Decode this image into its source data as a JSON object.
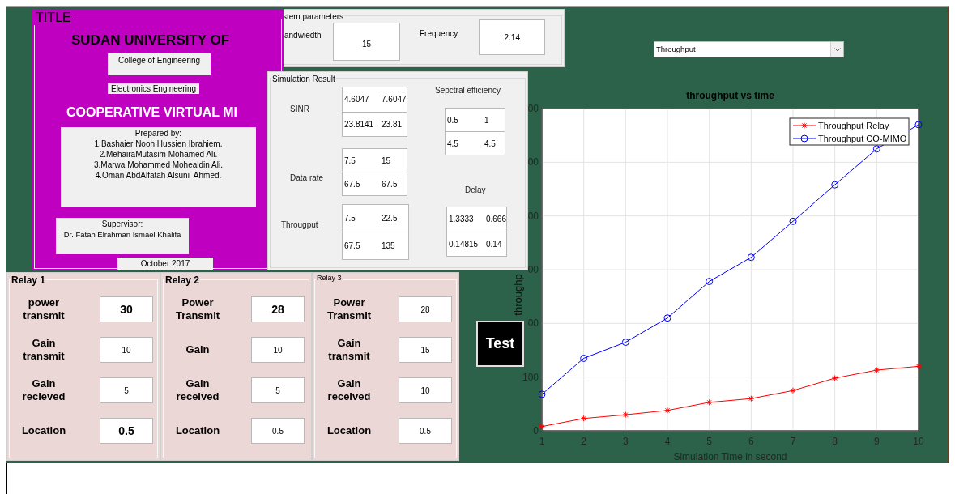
{
  "title_panel": {
    "label": "TITLE",
    "university": "SUDAN UNIVERSITY OF",
    "college": "College of Engineering",
    "department": "Electronics Engineering",
    "project": "COOPERATIVE VIRTUAL MI",
    "prepared_by": {
      "heading": "Prepared by:",
      "names": [
        "1.Bashaier Nooh Hussien Ibrahiem.",
        "2.MehairaMutasim Mohamed Ali.",
        "3.Marwa Mohammed Mohealdin Ali.",
        "4.Oman AbdAlfatah Alsuni  Ahmed."
      ]
    },
    "supervisor": {
      "heading": "Supervisor:",
      "name": "Dr. Fatah Elrahman Ismael Khalifa"
    },
    "date": "October 2017"
  },
  "system_parameters": {
    "label": "stem parameters",
    "fields": [
      {
        "label": "andwiedth",
        "value": "15"
      },
      {
        "label": "Frequency",
        "value": "2.14"
      }
    ]
  },
  "simulation_result": {
    "label": "Simulation Result",
    "groups": [
      {
        "label": "SINR",
        "rows": [
          [
            "4.6047",
            "7.6047"
          ],
          [
            "23.8141",
            "23.81"
          ]
        ]
      },
      {
        "label": "Data rate",
        "rows": [
          [
            "7.5",
            "15"
          ],
          [
            "67.5",
            "67.5"
          ]
        ]
      },
      {
        "label": "Througput",
        "rows": [
          [
            "7.5",
            "22.5"
          ],
          [
            "67.5",
            "135"
          ]
        ]
      },
      {
        "label": "Sepctral efficiency",
        "rows": [
          [
            "0.5",
            "1"
          ],
          [
            "4.5",
            "4.5"
          ]
        ]
      },
      {
        "label": "Delay",
        "rows": [
          [
            "1.3333",
            "0.666"
          ],
          [
            "0.14815",
            "0.14"
          ]
        ]
      }
    ]
  },
  "relays": [
    {
      "title": "Relay 1",
      "title_bold": true,
      "fields": [
        {
          "label": "power transmit",
          "value": "30",
          "bold": true
        },
        {
          "label": "Gain transmit",
          "value": "10",
          "bold": false
        },
        {
          "label": "Gain recieved",
          "value": "5",
          "bold": false
        },
        {
          "label": "Location",
          "value": "0.5",
          "bold": true
        }
      ]
    },
    {
      "title": "Relay 2",
      "title_bold": true,
      "fields": [
        {
          "label": "Power Transmit",
          "value": "28",
          "bold": true
        },
        {
          "label": "Gain",
          "value": "10",
          "bold": false
        },
        {
          "label": "Gain received",
          "value": "5",
          "bold": false
        },
        {
          "label": "Location",
          "value": "0.5",
          "bold": false
        }
      ]
    },
    {
      "title": "Relay 3",
      "title_bold": false,
      "fields": [
        {
          "label": "Power Transmit",
          "value": "28",
          "bold": false
        },
        {
          "label": "Gain transmit",
          "value": "15",
          "bold": false
        },
        {
          "label": "Gain received",
          "value": "10",
          "bold": false
        },
        {
          "label": "Location",
          "value": "0.5",
          "bold": false
        }
      ]
    }
  ],
  "test_button": "Test",
  "cut_tick_labels": [
    "00",
    "00",
    "00",
    "00",
    "00"
  ],
  "plot_selector": {
    "value": "Throughput"
  },
  "chart": {
    "chart_data": {
      "type": "line",
      "title": "throughput vs time",
      "xlabel": "Simulation Time in second",
      "ylabel": "throughp",
      "x": [
        1,
        2,
        3,
        4,
        5,
        6,
        7,
        8,
        9,
        10
      ],
      "series": [
        {
          "name": "Throughput Relay",
          "color": "#ff0000",
          "marker": "cross",
          "values": [
            8,
            23,
            30,
            38,
            53,
            60,
            75,
            98,
            113,
            120
          ]
        },
        {
          "name": "Throughput CO-MIMO",
          "color": "#0000ff",
          "marker": "circle",
          "values": [
            68,
            135,
            165,
            210,
            278,
            323,
            390,
            458,
            525,
            570
          ]
        }
      ],
      "grid": true,
      "legend": true,
      "xlim": [
        1,
        10
      ],
      "ylim": [
        0,
        600
      ],
      "xticks": [
        1,
        2,
        3,
        4,
        5,
        6,
        7,
        8,
        9,
        10
      ],
      "yticks": [
        0,
        100
      ]
    }
  }
}
